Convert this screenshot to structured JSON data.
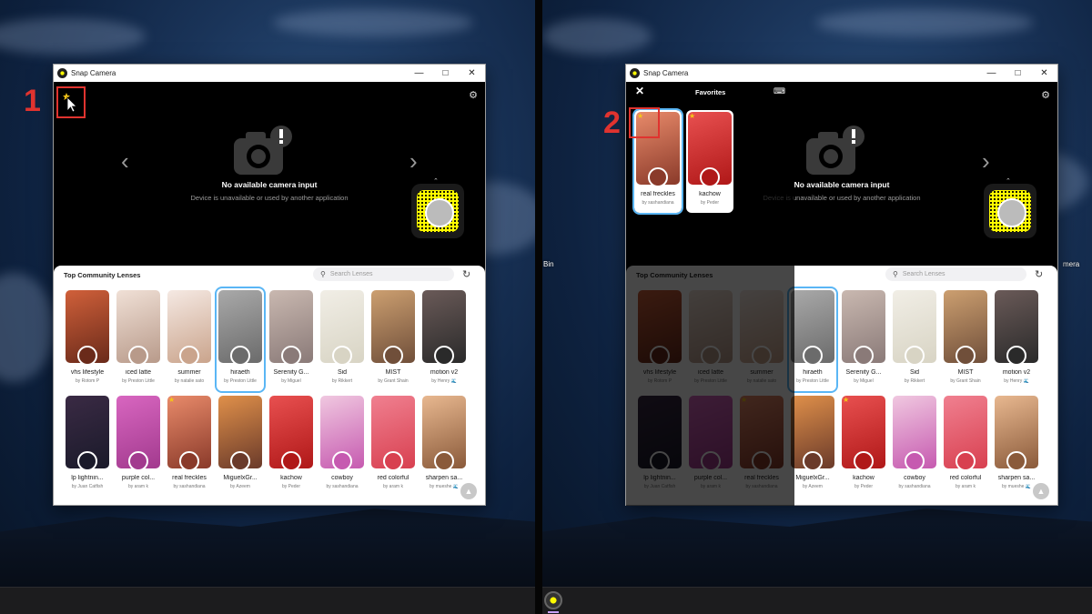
{
  "app": {
    "title": "Snap Camera"
  },
  "viewer": {
    "no_input_title": "No available camera input",
    "no_input_subtitle": "Device is unavailable or used by another application",
    "prev_label": "‹",
    "next_label": "›"
  },
  "panel": {
    "title": "Top Community Lenses",
    "search_placeholder": "Search Lenses"
  },
  "lenses": [
    {
      "name": "vhs lifestyle",
      "by": "by Rotom P",
      "c1": "#6a2a1a",
      "c2": "#d0603a"
    },
    {
      "name": "iced latte",
      "by": "by Preston Little",
      "c1": "#b89a8a",
      "c2": "#f0e0d6"
    },
    {
      "name": "summer",
      "by": "by natalie sato",
      "c1": "#caa48c",
      "c2": "#f5e9e3"
    },
    {
      "name": "hiraeth",
      "by": "by Preston Little",
      "c1": "#6b6b6b",
      "c2": "#a9a9a9"
    },
    {
      "name": "Serenity G...",
      "by": "by Miguel",
      "c1": "#8a7a78",
      "c2": "#c9b8b0"
    },
    {
      "name": "Sid",
      "by": "by Rikkert",
      "c1": "#d8d4c4",
      "c2": "#f1eee6"
    },
    {
      "name": "MIST",
      "by": "by Grant Shain",
      "c1": "#704f3a",
      "c2": "#cc9f70"
    },
    {
      "name": "motion v2",
      "by": "by Henry 🌊",
      "c1": "#2a2a2a",
      "c2": "#6a5a58"
    },
    {
      "name": "lp lightnin...",
      "by": "by Juan Catfish",
      "c1": "#1a1a2a",
      "c2": "#3a2a44"
    },
    {
      "name": "purple col...",
      "by": "by aram k",
      "c1": "#a23a8e",
      "c2": "#d866c0"
    },
    {
      "name": "real freckles",
      "by": "by sashandiana",
      "c1": "#8a3a2a",
      "c2": "#e88a6a"
    },
    {
      "name": "MiguelxGr...",
      "by": "by Azeem",
      "c1": "#6a3a2a",
      "c2": "#e0904a"
    },
    {
      "name": "kachow",
      "by": "by Peder",
      "c1": "#b01818",
      "c2": "#e85050"
    },
    {
      "name": "cowboy",
      "by": "by sashandiana",
      "c1": "#c65ab0",
      "c2": "#f0c8e0"
    },
    {
      "name": "red colorful",
      "by": "by aram k",
      "c1": "#d84050",
      "c2": "#f08090"
    },
    {
      "name": "sharpen sa...",
      "by": "by mueshe 🌊",
      "c1": "#8a5a3a",
      "c2": "#e8b890"
    }
  ],
  "favorites": {
    "title": "Favorites",
    "items": [
      {
        "name": "real freckles",
        "by": "by sashandiana",
        "c1": "#8a3a2a",
        "c2": "#e88a6a"
      },
      {
        "name": "kachow",
        "by": "by Peder",
        "c1": "#b01818",
        "c2": "#e85050"
      }
    ]
  },
  "markers": {
    "step1": "1",
    "step2": "2"
  },
  "desktop": {
    "icon_label_1": "Bin",
    "icon_label_2": "mera"
  },
  "icons": [
    "camera-icon",
    "gear-icon",
    "search-icon",
    "history-icon",
    "close-icon",
    "keyboard-icon",
    "star-icon",
    "chevron-up-icon"
  ],
  "colors": {
    "accent": "#5ab6f5",
    "marker": "#e0332f",
    "snapcode": "#fffc00"
  }
}
